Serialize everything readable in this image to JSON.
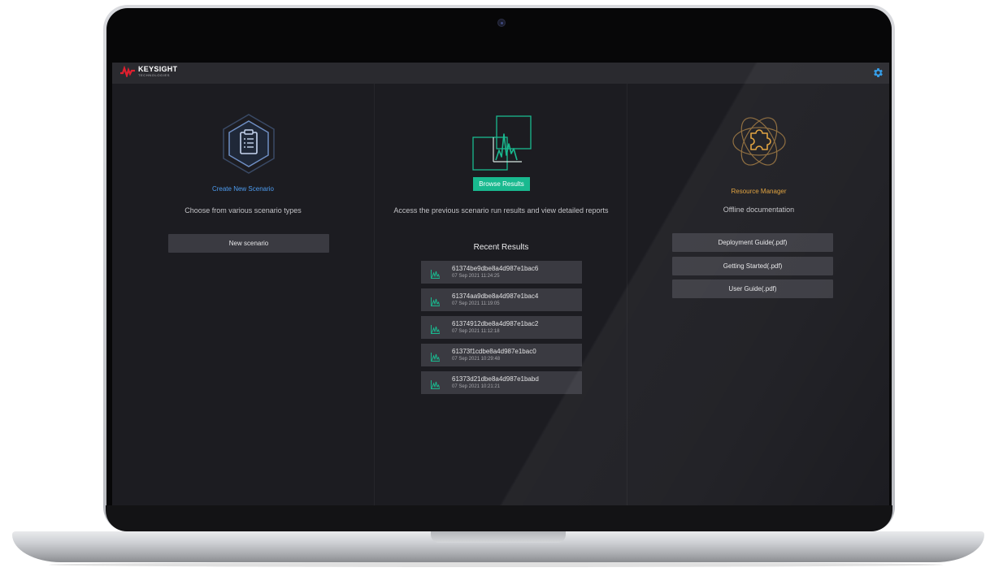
{
  "brand": {
    "name": "KEYSIGHT",
    "subtitle": "TECHNOLOGIES"
  },
  "header": {
    "settings_icon": "gear-icon"
  },
  "create": {
    "icon": "clipboard-hexagon-icon",
    "title": "Create New Scenario",
    "description": "Choose from various scenario types",
    "button_label": "New scenario"
  },
  "browse": {
    "icon": "results-chart-icon",
    "button_label": "Browse Results",
    "description": "Access the previous scenario run results and view detailed reports",
    "recent_heading": "Recent Results",
    "results": [
      {
        "id": "61374be9dbe8a4d987e1bac6",
        "time": "07 Sep 2021 11:24:25"
      },
      {
        "id": "61374aa9dbe8a4d987e1bac4",
        "time": "07 Sep 2021 11:19:05"
      },
      {
        "id": "61374912dbe8a4d987e1bac2",
        "time": "07 Sep 2021 11:12:18"
      },
      {
        "id": "61373f1cdbe8a4d987e1bac0",
        "time": "07 Sep 2021 10:29:48"
      },
      {
        "id": "61373d21dbe8a4d987e1babd",
        "time": "07 Sep 2021 10:21:21"
      }
    ]
  },
  "resources": {
    "icon": "puzzle-orbit-icon",
    "title": "Resource Manager",
    "description": "Offline documentation",
    "docs": [
      {
        "label": "Deployment Guide(.pdf)"
      },
      {
        "label": "Getting Started(.pdf)"
      },
      {
        "label": "User Guide(.pdf)"
      }
    ]
  },
  "colors": {
    "accent_blue": "#4d9cf0",
    "accent_green": "#19b98f",
    "accent_orange": "#e0a03a",
    "brand_red": "#e11f2e",
    "background": "#1c1c21"
  }
}
